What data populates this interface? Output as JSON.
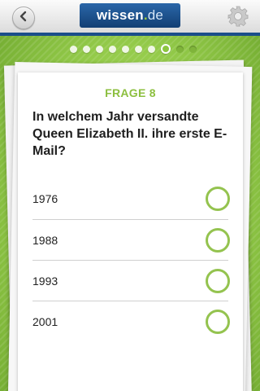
{
  "header": {
    "back_icon": "chevron-left-icon",
    "logo": {
      "name": "wissen",
      "dot": ".",
      "tld": "de"
    },
    "settings_icon": "gear-icon"
  },
  "progress": {
    "total": 10,
    "current": 8
  },
  "question": {
    "number_label": "FRAGE 8",
    "text": "In welchem Jahr versandte Queen Elizabeth II. ihre erste E-Mail?",
    "options": [
      {
        "label": "1976"
      },
      {
        "label": "1988"
      },
      {
        "label": "1993"
      },
      {
        "label": "2001"
      }
    ]
  },
  "colors": {
    "accent": "#8cc63f",
    "brand_blue": "#1b4e8a"
  }
}
